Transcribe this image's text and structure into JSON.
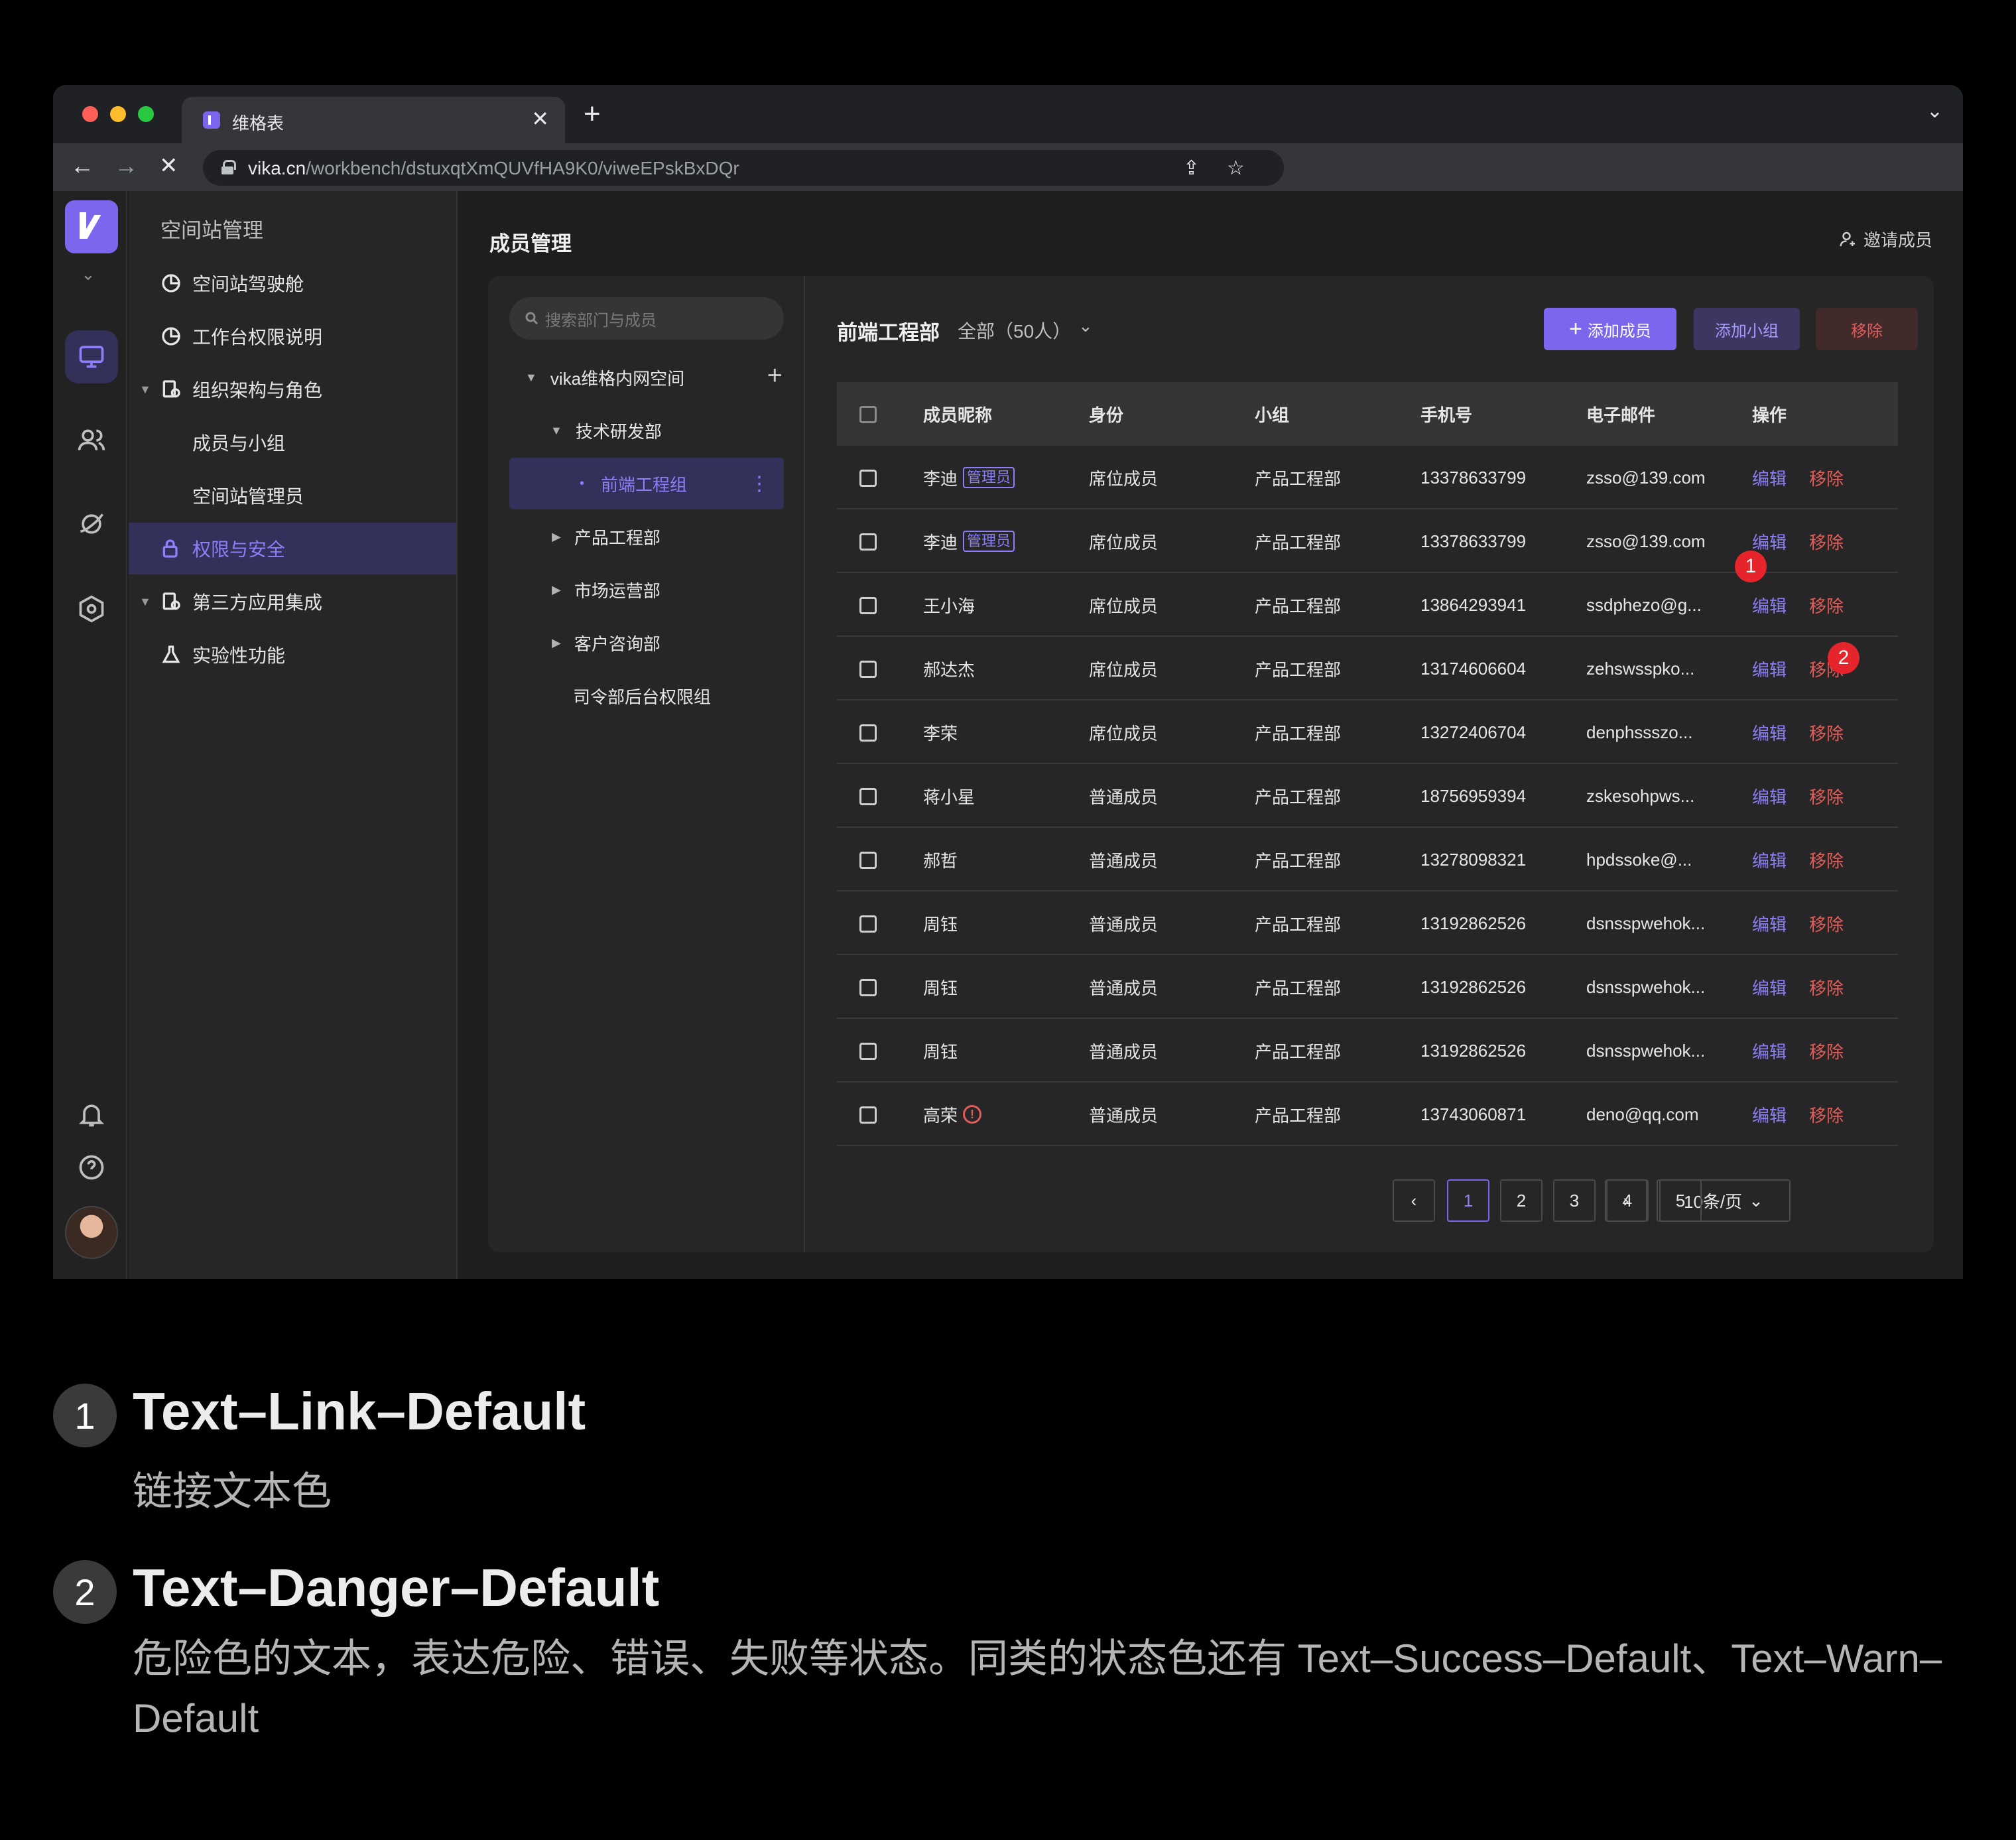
{
  "browser": {
    "tab_title": "维格表",
    "url_host": "vika.cn",
    "url_path": "/workbench/dstuxqtXmQUVfHA9K0/viweEPskBxDQr"
  },
  "sidebar": {
    "title": "空间站管理",
    "items": [
      {
        "label": "空间站驾驶舱",
        "icon": "pie-chart-icon"
      },
      {
        "label": "工作台权限说明",
        "icon": "pie-chart-icon"
      },
      {
        "label": "组织架构与角色",
        "icon": "org-icon"
      },
      {
        "label": "成员与小组"
      },
      {
        "label": "空间站管理员"
      },
      {
        "label": "权限与安全",
        "icon": "lock-icon"
      },
      {
        "label": "第三方应用集成",
        "icon": "app-icon"
      },
      {
        "label": "实验性功能",
        "icon": "flask-icon"
      }
    ]
  },
  "main": {
    "title": "成员管理",
    "invite_label": "邀请成员",
    "search_placeholder": "搜索部门与成员",
    "tree": [
      {
        "label": "vika维格内网空间"
      },
      {
        "label": "技术研发部"
      },
      {
        "label": "前端工程组"
      },
      {
        "label": "产品工程部"
      },
      {
        "label": "市场运营部"
      },
      {
        "label": "客户咨询部"
      },
      {
        "label": "司令部后台权限组"
      }
    ],
    "dept_title": "前端工程部",
    "dept_count": "全部（50人）",
    "buttons": {
      "add_member": "添加成员",
      "add_group": "添加小组",
      "remove": "移除"
    }
  },
  "table": {
    "headers": [
      "成员昵称",
      "身份",
      "小组",
      "手机号",
      "电子邮件",
      "操作"
    ],
    "admin_tag": "管理员",
    "edit_label": "编辑",
    "remove_label": "移除",
    "rows": [
      {
        "name": "李迪",
        "admin": true,
        "role": "席位成员",
        "group": "产品工程部",
        "phone": "13378633799",
        "email": "zsso@139.com"
      },
      {
        "name": "李迪",
        "admin": true,
        "role": "席位成员",
        "group": "产品工程部",
        "phone": "13378633799",
        "email": "zsso@139.com"
      },
      {
        "name": "王小海",
        "role": "席位成员",
        "group": "产品工程部",
        "phone": "13864293941",
        "email": "ssdphezo@g..."
      },
      {
        "name": "郝达杰",
        "role": "席位成员",
        "group": "产品工程部",
        "phone": "13174606604",
        "email": "zehswsspko..."
      },
      {
        "name": "李荣",
        "role": "席位成员",
        "group": "产品工程部",
        "phone": "13272406704",
        "email": "denphssszo..."
      },
      {
        "name": "蒋小星",
        "role": "普通成员",
        "group": "产品工程部",
        "phone": "18756959394",
        "email": "zskesohpws..."
      },
      {
        "name": "郝哲",
        "role": "普通成员",
        "group": "产品工程部",
        "phone": "13278098321",
        "email": "hpdssoke@..."
      },
      {
        "name": "周钰",
        "role": "普通成员",
        "group": "产品工程部",
        "phone": "13192862526",
        "email": "dsnsspwehok..."
      },
      {
        "name": "周钰",
        "role": "普通成员",
        "group": "产品工程部",
        "phone": "13192862526",
        "email": "dsnsspwehok..."
      },
      {
        "name": "周钰",
        "role": "普通成员",
        "group": "产品工程部",
        "phone": "13192862526",
        "email": "dsnsspwehok..."
      },
      {
        "name": "高荣",
        "warning": true,
        "role": "普通成员",
        "group": "产品工程部",
        "phone": "13743060871",
        "email": "deno@qq.com"
      }
    ]
  },
  "pagination": {
    "pages": [
      "1",
      "2",
      "3",
      "4",
      "5"
    ],
    "current": "1",
    "page_size": "10条/页"
  },
  "markers": [
    "1",
    "2"
  ],
  "legend": [
    {
      "num": "1",
      "title": "Text–Link–Default",
      "desc": "链接文本色"
    },
    {
      "num": "2",
      "title": "Text–Danger–Default",
      "desc": "危险色的文本，表达危险、错误、失败等状态。同类的状态色还有 Text–Success–Default、Text–Warn–Default"
    }
  ],
  "colors": {
    "link": "#8d7ffa",
    "danger": "#e25c5c",
    "accent": "#7b67ee"
  }
}
